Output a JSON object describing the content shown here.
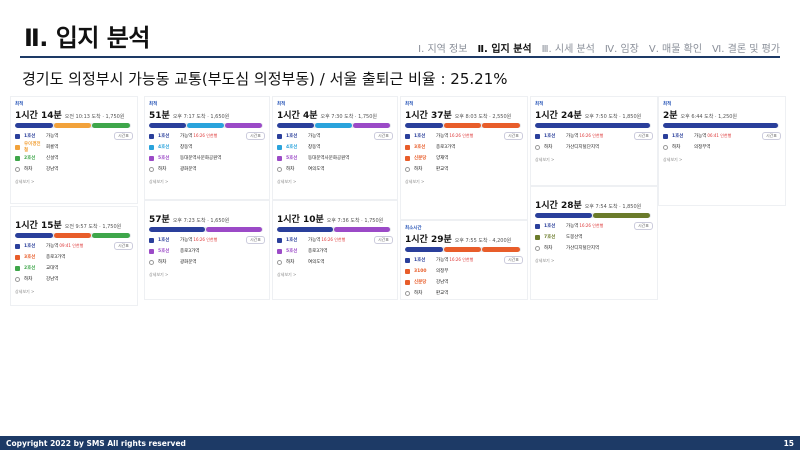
{
  "header": {
    "title": "Ⅱ. 입지 분석",
    "nav": [
      "Ⅰ. 지역 정보",
      "Ⅱ. 입지 분석",
      "Ⅲ. 시세 분석",
      "Ⅳ. 임장",
      "Ⅴ. 매물 확인",
      "Ⅵ. 결론 및 평가"
    ],
    "active_index": 1
  },
  "subtitle": "경기도 의정부시 가능동 교통(부도심 의정부동) / 서울 출퇴근 비율 : 25.21%",
  "footer": {
    "copyright": "Copyright 2022 by SMS All rights reserved",
    "page_number": "15"
  },
  "colors": {
    "accent": "#1d3a66",
    "line1": "#2a3f9b",
    "line2": "#3ea64a",
    "line4": "#2aa3dc",
    "line5": "#9b4ac7",
    "line7": "#6b7b2b",
    "bus": "#e85d2a",
    "uijeongbu": "#f2a23b"
  },
  "cards": [
    {
      "tag": "최적",
      "time_h": "1",
      "time_m": "14",
      "meta": "오전 10:13 도착 · 1,750원",
      "rows": [
        {
          "line": "1호선",
          "station": "가능역",
          "sub": "",
          "color": "line1"
        },
        {
          "line": "우이경전철",
          "station": "회룡역",
          "sub": "",
          "color": "uijeongbu"
        },
        {
          "line": "2호선",
          "station": "신설역",
          "sub": "",
          "color": "line2"
        },
        {
          "line": "하차",
          "station": "강남역",
          "sub": "",
          "color": "none"
        }
      ]
    },
    {
      "tag": "",
      "time_h": "1",
      "time_m": "15",
      "meta": "오전 9:57 도착 · 1,750원",
      "rows": [
        {
          "line": "1호선",
          "station": "가능역",
          "sub": "09:41 인천행",
          "color": "line1"
        },
        {
          "line": "3호선",
          "station": "종로3가역",
          "sub": "",
          "color": "bus"
        },
        {
          "line": "2호선",
          "station": "교대역",
          "sub": "",
          "color": "line2"
        },
        {
          "line": "하차",
          "station": "강남역",
          "sub": "",
          "color": "none"
        }
      ]
    },
    {
      "tag": "최적",
      "time_h": "",
      "time_m": "51",
      "meta": "오후 7:17 도착 · 1,650원",
      "rows": [
        {
          "line": "1호선",
          "station": "가능역",
          "sub": "16:26 인천행",
          "color": "line1"
        },
        {
          "line": "4호선",
          "station": "창동역",
          "sub": "",
          "color": "line4"
        },
        {
          "line": "5호선",
          "station": "동대문역사문화공원역",
          "sub": "",
          "color": "line5"
        },
        {
          "line": "하차",
          "station": "광화문역",
          "sub": "",
          "color": "none"
        }
      ]
    },
    {
      "tag": "",
      "time_h": "",
      "time_m": "57",
      "meta": "오후 7:23 도착 · 1,650원",
      "rows": [
        {
          "line": "1호선",
          "station": "가능역",
          "sub": "16:26 인천행",
          "color": "line1"
        },
        {
          "line": "5호선",
          "station": "종로3가역",
          "sub": "",
          "color": "line5"
        },
        {
          "line": "하차",
          "station": "광화문역",
          "sub": "",
          "color": "none"
        }
      ]
    },
    {
      "tag": "최적",
      "time_h": "1",
      "time_m": "4",
      "meta": "오후 7:30 도착 · 1,750원",
      "rows": [
        {
          "line": "1호선",
          "station": "가능역",
          "sub": "",
          "color": "line1"
        },
        {
          "line": "4호선",
          "station": "창동역",
          "sub": "",
          "color": "line4"
        },
        {
          "line": "5호선",
          "station": "동대문역사문화공원역",
          "sub": "",
          "color": "line5"
        },
        {
          "line": "하차",
          "station": "여의도역",
          "sub": "",
          "color": "none"
        }
      ]
    },
    {
      "tag": "",
      "time_h": "1",
      "time_m": "10",
      "meta": "오후 7:36 도착 · 1,750원",
      "rows": [
        {
          "line": "1호선",
          "station": "가능역",
          "sub": "16:26 인천행",
          "color": "line1"
        },
        {
          "line": "5호선",
          "station": "종로3가역",
          "sub": "",
          "color": "line5"
        },
        {
          "line": "하차",
          "station": "여의도역",
          "sub": "",
          "color": "none"
        }
      ]
    },
    {
      "tag": "최적",
      "time_h": "1",
      "time_m": "37",
      "meta": "오후 8:03 도착 · 2,550원",
      "rows": [
        {
          "line": "1호선",
          "station": "가능역",
          "sub": "16:26 인천행",
          "color": "line1"
        },
        {
          "line": "3호선",
          "station": "종로3가역",
          "sub": "",
          "color": "bus"
        },
        {
          "line": "신분당",
          "station": "양재역",
          "sub": "",
          "color": "bus"
        },
        {
          "line": "하차",
          "station": "판교역",
          "sub": "",
          "color": "none"
        }
      ]
    },
    {
      "tag": "최소시간",
      "time_h": "1",
      "time_m": "29",
      "meta": "오후 7:55 도착 · 4,200원",
      "rows": [
        {
          "line": "1호선",
          "station": "가능역",
          "sub": "16:26 인천행",
          "color": "line1"
        },
        {
          "line": "3100",
          "station": "의정부",
          "sub": "",
          "color": "bus"
        },
        {
          "line": "신분당",
          "station": "강남역",
          "sub": "",
          "color": "bus"
        },
        {
          "line": "하차",
          "station": "판교역",
          "sub": "",
          "color": "none"
        }
      ]
    },
    {
      "tag": "최적",
      "time_h": "1",
      "time_m": "24",
      "meta": "오후 7:50 도착 · 1,850원",
      "rows": [
        {
          "line": "1호선",
          "station": "가능역",
          "sub": "16:26 인천행",
          "color": "line1"
        },
        {
          "line": "하차",
          "station": "가산디지털단지역",
          "sub": "",
          "color": "none"
        }
      ]
    },
    {
      "tag": "",
      "time_h": "1",
      "time_m": "28",
      "meta": "오후 7:54 도착 · 1,850원",
      "rows": [
        {
          "line": "1호선",
          "station": "가능역",
          "sub": "16:26 인천행",
          "color": "line1"
        },
        {
          "line": "7호선",
          "station": "도봉산역",
          "sub": "",
          "color": "line7"
        },
        {
          "line": "하차",
          "station": "가산디지털단지역",
          "sub": "",
          "color": "none"
        }
      ]
    },
    {
      "tag": "최적",
      "time_h": "",
      "time_m": "2",
      "meta": "오후 6:44 도착 · 1,250원",
      "rows": [
        {
          "line": "1호선",
          "station": "가능역",
          "sub": "06:41 인천행",
          "color": "line1"
        },
        {
          "line": "하차",
          "station": "의정부역",
          "sub": "",
          "color": "none"
        }
      ]
    }
  ],
  "labels": {
    "more": "상세보기 >",
    "btn": "시간표",
    "min": "분",
    "hour": "시간"
  }
}
